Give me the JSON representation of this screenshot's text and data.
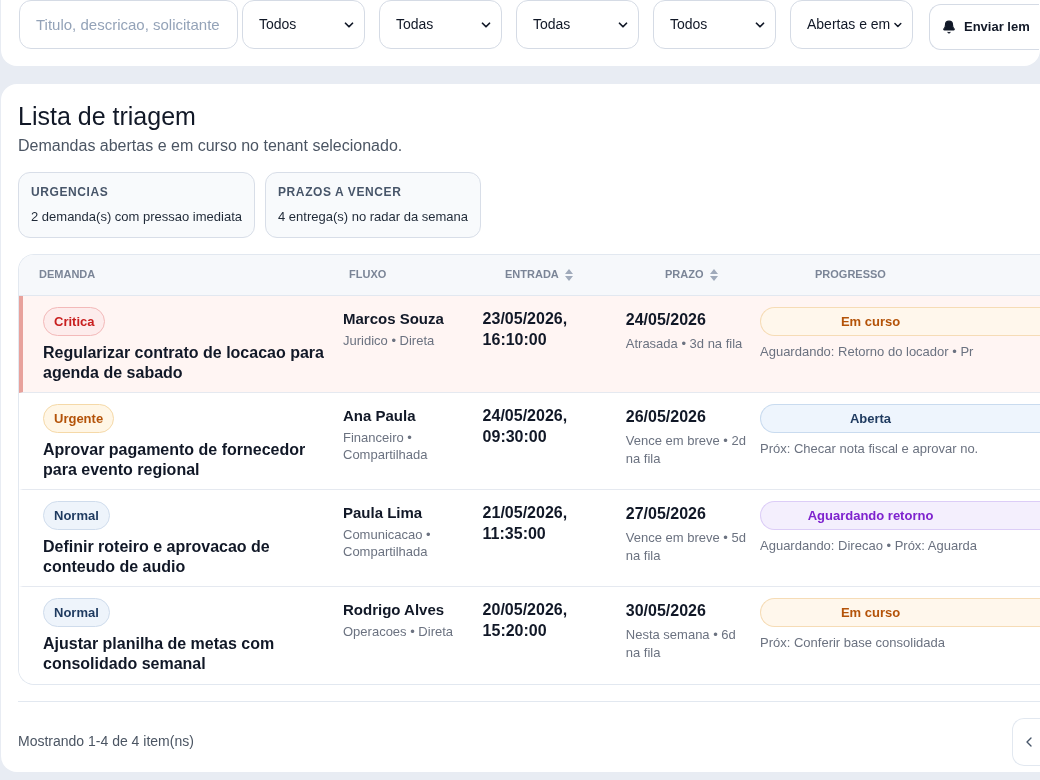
{
  "filters": {
    "search": {
      "placeholder": "Titulo, descricao, solicitante"
    },
    "selects": [
      {
        "value": "Todos"
      },
      {
        "value": "Todas"
      },
      {
        "value": "Todas"
      },
      {
        "value": "Todos"
      },
      {
        "value": "Abertas e em"
      }
    ],
    "reminder_button": "Enviar lem"
  },
  "list": {
    "title": "Lista de triagem",
    "subtitle": "Demandas abertas e em curso no tenant selecionado.",
    "summaries": [
      {
        "label": "URGENCIAS",
        "text": "2 demanda(s) com pressao imediata"
      },
      {
        "label": "PRAZOS A VENCER",
        "text": "4 entrega(s) no radar da semana"
      }
    ],
    "table": {
      "columns": [
        {
          "label": "DEMANDA",
          "sortable": false
        },
        {
          "label": "FLUXO",
          "sortable": false
        },
        {
          "label": "ENTRADA",
          "sortable": true
        },
        {
          "label": "PRAZO",
          "sortable": true
        },
        {
          "label": "PROGRESSO",
          "sortable": false
        }
      ],
      "rows": [
        {
          "priority": {
            "label": "Critica",
            "kind": "critical"
          },
          "title": "Regularizar contrato de locacao para agenda de sabado",
          "owner": "Marcos Souza",
          "flow": "Juridico • Direta",
          "entry": "23/05/2026, 16:10:00",
          "due": "24/05/2026",
          "due_note": "Atrasada • 3d na fila",
          "status": {
            "label": "Em curso",
            "kind": "in_progress"
          },
          "progress_note": "Aguardando: Retorno do locador • Pr"
        },
        {
          "priority": {
            "label": "Urgente",
            "kind": "urgent"
          },
          "title": "Aprovar pagamento de fornecedor para evento regional",
          "owner": "Ana Paula",
          "flow": "Financeiro • Compartilhada",
          "entry": "24/05/2026, 09:30:00",
          "due": "26/05/2026",
          "due_note": "Vence em breve • 2d na fila",
          "status": {
            "label": "Aberta",
            "kind": "open"
          },
          "progress_note": "Próx: Checar nota fiscal e aprovar no."
        },
        {
          "priority": {
            "label": "Normal",
            "kind": "normal"
          },
          "title": "Definir roteiro e aprovacao de conteudo de audio",
          "owner": "Paula Lima",
          "flow": "Comunicacao • Compartilhada",
          "entry": "21/05/2026, 11:35:00",
          "due": "27/05/2026",
          "due_note": "Vence em breve • 5d na fila",
          "status": {
            "label": "Aguardando retorno",
            "kind": "waiting"
          },
          "progress_note": "Aguardando: Direcao • Próx: Aguarda"
        },
        {
          "priority": {
            "label": "Normal",
            "kind": "normal"
          },
          "title": "Ajustar planilha de metas com consolidado semanal",
          "owner": "Rodrigo Alves",
          "flow": "Operacoes • Direta",
          "entry": "20/05/2026, 15:20:00",
          "due": "30/05/2026",
          "due_note": "Nesta semana • 6d na fila",
          "status": {
            "label": "Em curso",
            "kind": "in_progress"
          },
          "progress_note": "Próx: Conferir base consolidada"
        }
      ]
    },
    "footer": "Mostrando 1-4 de 4 item(ns)"
  }
}
